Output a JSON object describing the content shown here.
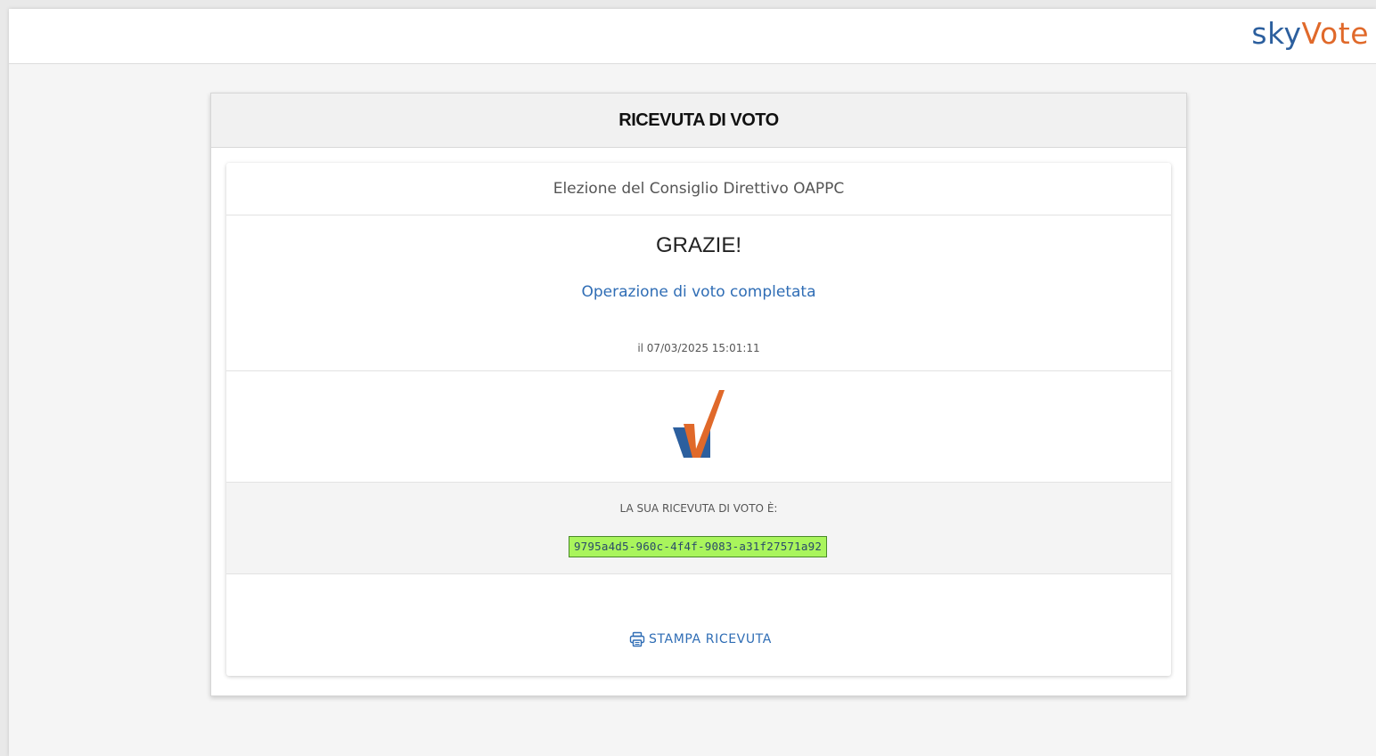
{
  "brand": {
    "part1": "sky",
    "part2": "Vote"
  },
  "panel": {
    "title": "RICEVUTA DI VOTO"
  },
  "card": {
    "election_name": "Elezione del Consiglio Direttivo OAPPC",
    "thanks": "GRAZIE!",
    "completed": "Operazione di voto completata",
    "timestamp": "il 07/03/2025 15:01:11",
    "receipt_label": "LA SUA RICEVUTA DI VOTO È:",
    "receipt_code": "9795a4d5-960c-4f4f-9083-a31f27571a92",
    "print_label": "STAMPA RICEVUTA"
  },
  "icons": {
    "logo": "vote-check-icon",
    "print": "printer-icon"
  },
  "colors": {
    "accent_blue": "#2f6db5",
    "brand_blue": "#2c5f9e",
    "brand_orange": "#e0692a",
    "receipt_highlight": "#a9f55c"
  }
}
